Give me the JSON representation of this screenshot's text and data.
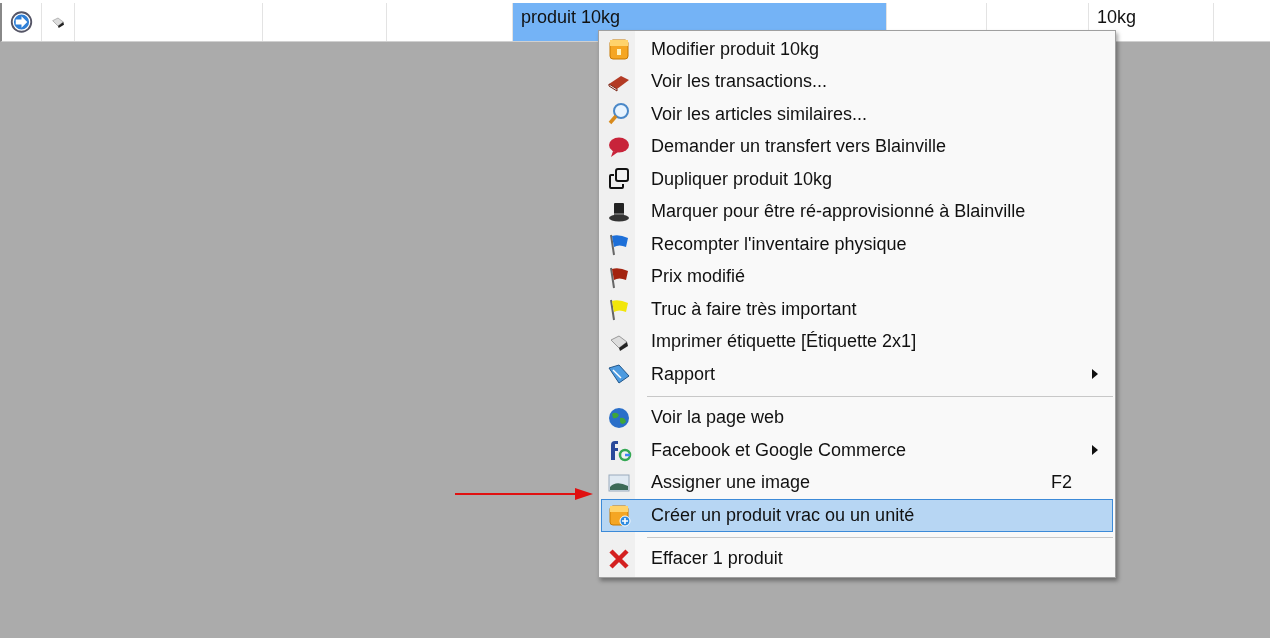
{
  "table": {
    "rows": [
      {
        "cells": [
          {
            "selected": false
          },
          {
            "selected": false
          },
          {
            "selected": false
          },
          {
            "selected": false
          },
          {
            "selected": false
          },
          {
            "text": "produit 10kg",
            "selected": true
          },
          {
            "selected": false
          },
          {
            "selected": false
          },
          {
            "text": "10kg",
            "selected": false
          },
          {
            "selected": false
          }
        ]
      }
    ]
  },
  "context_menu": {
    "items": [
      {
        "kind": "item",
        "label": "Modifier produit 10kg",
        "selected": false
      },
      {
        "kind": "item",
        "label": "Voir les transactions...",
        "selected": false
      },
      {
        "kind": "item",
        "label": "Voir les articles similaires...",
        "selected": false
      },
      {
        "kind": "item",
        "label": "Demander un transfert vers Blainville",
        "selected": false
      },
      {
        "kind": "item",
        "label": "Dupliquer produit 10kg",
        "selected": false
      },
      {
        "kind": "item",
        "label": "Marquer pour être ré-approvisionné à Blainville",
        "selected": false
      },
      {
        "kind": "item",
        "label": "Recompter l'inventaire physique",
        "selected": false
      },
      {
        "kind": "item",
        "label": "Prix modifié",
        "selected": false
      },
      {
        "kind": "item",
        "label": "Truc à faire très important",
        "selected": false
      },
      {
        "kind": "item",
        "label": "Imprimer étiquette [Étiquette 2x1]",
        "selected": false
      },
      {
        "kind": "item",
        "label": "Rapport",
        "selected": false,
        "submenu": true
      },
      {
        "kind": "separator"
      },
      {
        "kind": "item",
        "label": "Voir la page web",
        "selected": false
      },
      {
        "kind": "item",
        "label": "Facebook et Google Commerce",
        "selected": false,
        "submenu": true
      },
      {
        "kind": "item",
        "label": "Assigner une image",
        "selected": false,
        "shortcut": "F2"
      },
      {
        "kind": "item",
        "label": "Créer un produit vrac ou un unité",
        "selected": true
      },
      {
        "kind": "separator"
      },
      {
        "kind": "item",
        "label": "Effacer 1 produit",
        "selected": false
      }
    ]
  }
}
